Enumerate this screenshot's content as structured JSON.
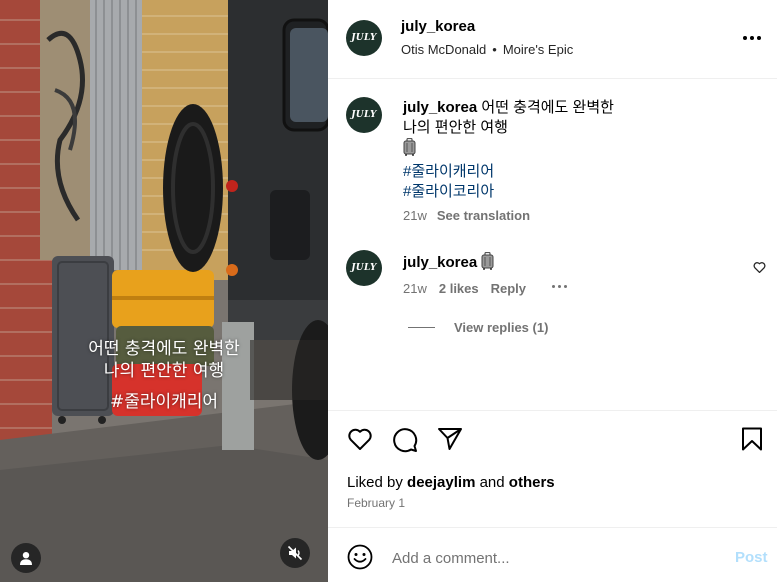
{
  "media": {
    "overlay_line1": "어떤 충격에도 완벽한",
    "overlay_line2": "나의 편안한 여행",
    "overlay_line3": "#줄라이캐리어"
  },
  "header": {
    "avatar_text": "JULY",
    "username": "july_korea",
    "audio_artist": "Otis McDonald",
    "separator": "•",
    "audio_track": "Moire's Epic"
  },
  "caption": {
    "avatar_text": "JULY",
    "username": "july_korea",
    "line1": "어떤 충격에도 완벽한",
    "line2": "나의 편안한 여행",
    "hashtag1": "#줄라이캐리어",
    "hashtag2": "#줄라이코리아",
    "time": "21w",
    "translate": "See translation"
  },
  "comment": {
    "avatar_text": "JULY",
    "username": "july_korea",
    "time": "21w",
    "likes": "2 likes",
    "reply": "Reply",
    "view_replies": "View replies (1)"
  },
  "likes": {
    "prefix": "Liked by",
    "user": "deejaylim",
    "and": "and",
    "others": "others"
  },
  "date": "February 1",
  "composer": {
    "placeholder": "Add a comment...",
    "post": "Post"
  },
  "colors": {
    "avatar_bg": "#1d332b",
    "hashtag": "#00376b",
    "muted": "#737373",
    "post_disabled": "#b2dffc"
  }
}
